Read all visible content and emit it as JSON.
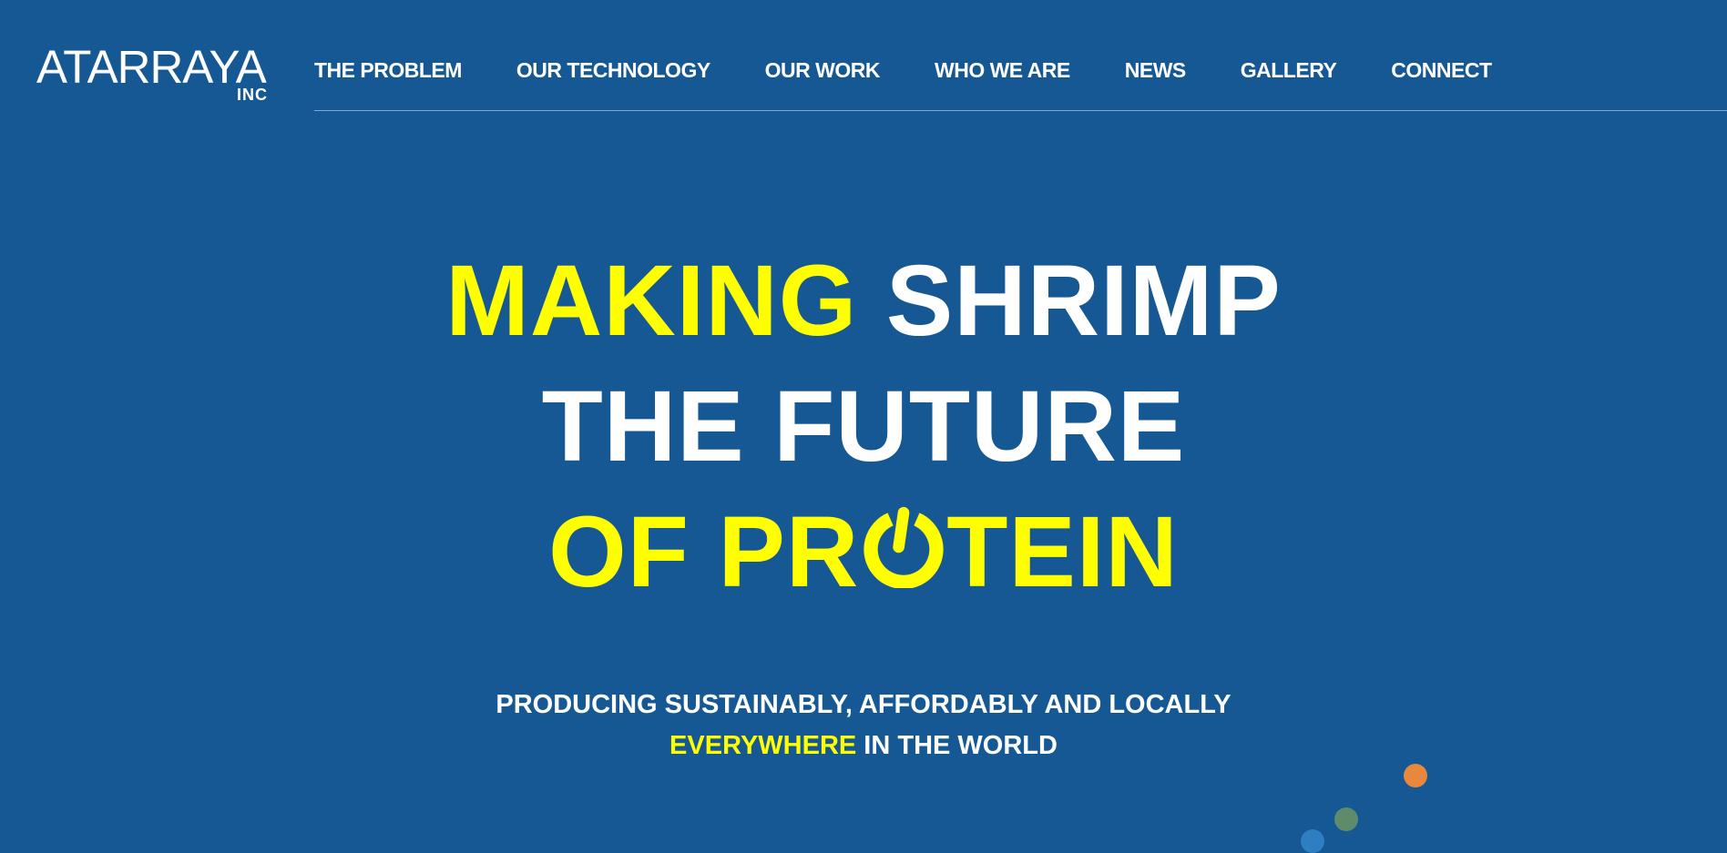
{
  "logo": {
    "name": "ATARRAYA",
    "suffix": "INC"
  },
  "nav": {
    "items": [
      {
        "label": "THE PROBLEM"
      },
      {
        "label": "OUR TECHNOLOGY"
      },
      {
        "label": "OUR WORK"
      },
      {
        "label": "WHO WE ARE"
      },
      {
        "label": "NEWS"
      },
      {
        "label": "GALLERY"
      },
      {
        "label": "CONNECT"
      }
    ]
  },
  "hero": {
    "line1_a": "MAKING",
    "line1_b": "SHRIMP",
    "line2": "THE FUTURE",
    "line3_a": "OF PR",
    "line3_o_icon": "power-icon",
    "line3_b": "TEIN"
  },
  "subtitle": {
    "line1": "PRODUCING SUSTAINABLY, AFFORDABLY AND LOCALLY",
    "line2_a": "EVERYWHERE",
    "line2_b": "IN THE WORLD"
  },
  "colors": {
    "background": "#155894",
    "accent": "#ffff00",
    "text": "#ffffff",
    "dot_orange": "#e8883c",
    "dot_green": "#5e8c6a",
    "dot_blue": "#2e7fc2"
  }
}
